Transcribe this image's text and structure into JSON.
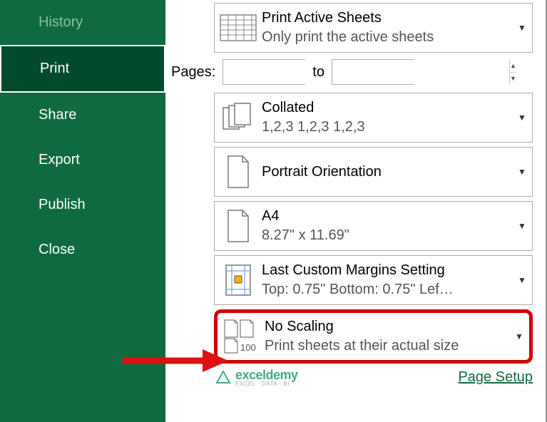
{
  "sidebar": {
    "items": [
      {
        "label": "History",
        "dim": true
      },
      {
        "label": "Print",
        "selected": true
      },
      {
        "label": "Share"
      },
      {
        "label": "Export"
      },
      {
        "label": "Publish"
      },
      {
        "label": "Close"
      }
    ]
  },
  "pages": {
    "label": "Pages:",
    "to_label": "to",
    "from_value": "",
    "to_value": ""
  },
  "settings": {
    "print_what": {
      "title": "Print Active Sheets",
      "sub": "Only print the active sheets"
    },
    "collation": {
      "title": "Collated",
      "sub": "1,2,3    1,2,3    1,2,3"
    },
    "orientation": {
      "title": "Portrait Orientation"
    },
    "paper": {
      "title": "A4",
      "sub": "8.27\" x 11.69\""
    },
    "margins": {
      "title": "Last Custom Margins Setting",
      "sub": "Top: 0.75\" Bottom: 0.75\" Lef…"
    },
    "scaling": {
      "title": "No Scaling",
      "sub": "Print sheets at their actual size",
      "badge": "100"
    }
  },
  "footer": {
    "watermark_brand": "exceldemy",
    "watermark_sub": "EXCEL · DATA · BI",
    "page_setup": "Page Setup"
  }
}
